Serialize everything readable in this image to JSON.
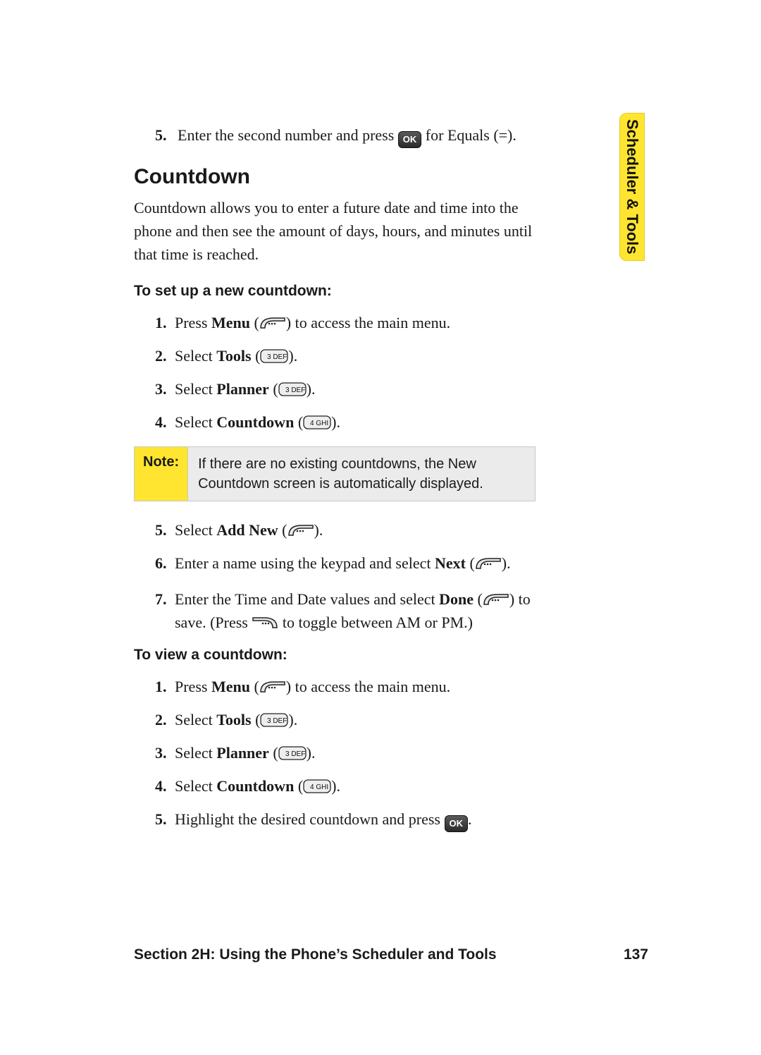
{
  "tab_label": "Scheduler & Tools",
  "continue_step": {
    "num": "5.",
    "before": "Enter the second number and press ",
    "after": " for Equals (=)."
  },
  "heading": "Countdown",
  "intro": "Countdown allows you to enter a future date and time into the phone and then see the amount of days, hours, and minutes until that time is reached.",
  "subhead_setup": "To set up a new countdown:",
  "steps_setup": [
    {
      "num": "1.",
      "pre": "Press ",
      "bold": "Menu",
      "post_open": " (",
      "post_close": ") to access the main menu.",
      "icon": "soft-left"
    },
    {
      "num": "2.",
      "pre": "Select ",
      "bold": "Tools",
      "post_open": " (",
      "post_close": ").",
      "icon": "key-3"
    },
    {
      "num": "3.",
      "pre": "Select ",
      "bold": "Planner",
      "post_open": " (",
      "post_close": ").",
      "icon": "key-3"
    },
    {
      "num": "4.",
      "pre": "Select ",
      "bold": "Countdown",
      "post_open": " (",
      "post_close": ").",
      "icon": "key-4"
    }
  ],
  "note_label": "Note:",
  "note_text": "If there are no existing countdowns, the New Countdown screen is automatically displayed.",
  "steps_setup2": [
    {
      "num": "5.",
      "pre": "Select ",
      "bold": "Add New",
      "post_open": " (",
      "post_close": ").",
      "icon": "soft-left"
    },
    {
      "num": "6.",
      "pre": "Enter a name using the keypad and select ",
      "bold": "Next",
      "post_open": " (",
      "post_close": ").",
      "icon": "soft-left"
    }
  ],
  "step7": {
    "num": "7.",
    "pre": "Enter the Time and Date values and select ",
    "bold": "Done",
    "post_open": " (",
    "post_close": ") to save. (Press ",
    "tail": " to toggle between AM or PM.)"
  },
  "subhead_view": "To view a countdown:",
  "steps_view": [
    {
      "num": "1.",
      "pre": "Press ",
      "bold": "Menu",
      "post_open": " (",
      "post_close": ") to access the main menu.",
      "icon": "soft-left"
    },
    {
      "num": "2.",
      "pre": "Select ",
      "bold": "Tools",
      "post_open": " (",
      "post_close": ").",
      "icon": "key-3"
    },
    {
      "num": "3.",
      "pre": "Select ",
      "bold": "Planner",
      "post_open": " (",
      "post_close": ").",
      "icon": "key-3"
    },
    {
      "num": "4.",
      "pre": "Select ",
      "bold": "Countdown",
      "post_open": " (",
      "post_close": ").",
      "icon": "key-4"
    },
    {
      "num": "5.",
      "pre": "Highlight the desired countdown and press ",
      "bold": "",
      "post_open": "",
      "post_close": ".",
      "icon": "ok"
    }
  ],
  "footer_left": "Section 2H: Using the Phone’s Scheduler and Tools",
  "footer_right": "137",
  "key_labels": {
    "ok": "OK",
    "k3": "3 DEF",
    "k4": "4 GHI"
  }
}
